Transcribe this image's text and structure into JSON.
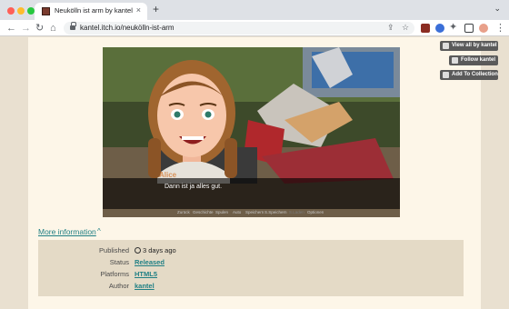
{
  "browser": {
    "tab_title": "Neukölln ist arm by kantel",
    "tab_close": "×",
    "new_tab": "+",
    "url": "kantel.itch.io/neukölln-ist-arm",
    "icons": [
      "back-icon",
      "forward-icon",
      "reload-icon",
      "home-icon",
      "lock-icon",
      "share-icon",
      "star-icon",
      "extensions-icon",
      "sidebar-icon",
      "profile-icon",
      "menu-icon"
    ]
  },
  "game": {
    "speaker": "Alice",
    "dialogue": "Dann ist ja alles gut.",
    "menu": [
      "Zurück",
      "Geschichte",
      "Spulen",
      "Auto",
      "Speichern",
      "S.Speichern",
      "S.Laden",
      "Optionen"
    ]
  },
  "actions": {
    "view_all": "View all by kantel",
    "follow": "Follow kantel",
    "add_collection": "Add To Collection"
  },
  "more_info": {
    "label": "More information",
    "caret": "^"
  },
  "info": [
    {
      "key": "Published",
      "value": "3 days ago"
    },
    {
      "key": "Status",
      "value": "Released"
    },
    {
      "key": "Platforms",
      "value": "HTML5"
    },
    {
      "key": "Author",
      "value": "kantel"
    }
  ],
  "colors": {
    "page_bg": "#e9e0d0",
    "column_bg": "#fdf6e8",
    "link": "#1f7f84",
    "panel_bg": "#e4dac6",
    "button_bg": "#5a5a5a"
  }
}
